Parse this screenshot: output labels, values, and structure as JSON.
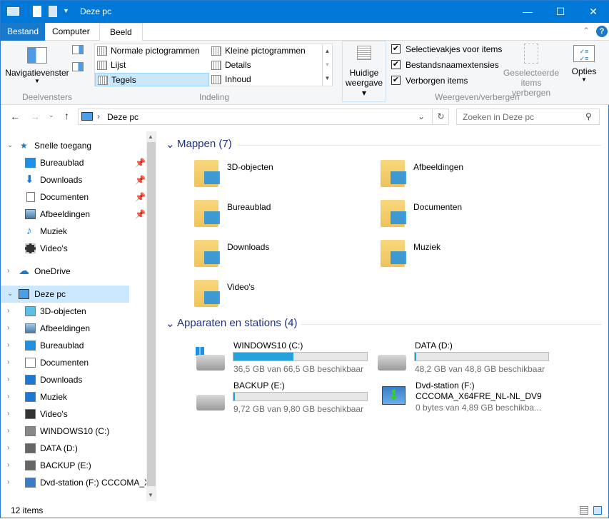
{
  "window": {
    "title": "Deze pc",
    "minimize": "—",
    "maximize": "☐",
    "close": "✕"
  },
  "ribbon_tabs": [
    {
      "label": "Bestand"
    },
    {
      "label": "Computer"
    },
    {
      "label": "Beeld"
    }
  ],
  "ribbon": {
    "nav_pane": "Navigatievenster",
    "group_panes": "Deelvensters",
    "layouts": [
      "Normale pictogrammen",
      "Kleine pictogrammen",
      "Lijst",
      "Details",
      "Tegels",
      "Inhoud"
    ],
    "selected_layout": "Tegels",
    "group_layout": "Indeling",
    "current_view_1": "Huidige",
    "current_view_2": "weergave",
    "checks": [
      {
        "label": "Selectievakjes voor items",
        "checked": true
      },
      {
        "label": "Bestandsnaamextensies",
        "checked": true
      },
      {
        "label": "Verborgen items",
        "checked": true
      }
    ],
    "hide_selected_1": "Geselecteerde",
    "hide_selected_2": "items verbergen",
    "options": "Opties",
    "group_show": "Weergeven/verbergen"
  },
  "address": {
    "path": "Deze pc",
    "search_placeholder": "Zoeken in Deze pc"
  },
  "nav": {
    "quick": "Snelle toegang",
    "quick_items": [
      "Bureaublad",
      "Downloads",
      "Documenten",
      "Afbeeldingen",
      "Muziek",
      "Video's"
    ],
    "onedrive": "OneDrive",
    "thispc": "Deze pc",
    "pc_items": [
      "3D-objecten",
      "Afbeeldingen",
      "Bureaublad",
      "Documenten",
      "Downloads",
      "Muziek",
      "Video's",
      "WINDOWS10 (C:)",
      "DATA (D:)",
      "BACKUP (E:)",
      "Dvd-station (F:) CCCOMA_X64FRE_NL-NL_DV9"
    ]
  },
  "folders": {
    "header": "Mappen (7)",
    "items": [
      "3D-objecten",
      "Afbeeldingen",
      "Bureaublad",
      "Documenten",
      "Downloads",
      "Muziek",
      "Video's"
    ]
  },
  "devices": {
    "header": "Apparaten en stations (4)",
    "items": [
      {
        "name": "WINDOWS10 (C:)",
        "info": "36,5 GB van 66,5 GB beschikbaar",
        "used_percent": 45
      },
      {
        "name": "DATA (D:)",
        "info": "48,2 GB van 48,8 GB beschikbaar",
        "used_percent": 1.2
      },
      {
        "name": "BACKUP (E:)",
        "info": "9,72 GB van 9,80 GB beschikbaar",
        "used_percent": 0.8
      },
      {
        "name": "Dvd-station (F:)",
        "label": "CCCOMA_X64FRE_NL-NL_DV9",
        "info": "0 bytes van 4,89 GB beschikba..."
      }
    ]
  },
  "status": {
    "count": "12 items"
  },
  "colors": {
    "accent": "#0078d7",
    "selection": "#cce8ff",
    "bar": "#26a0da",
    "section": "#1e3287"
  }
}
